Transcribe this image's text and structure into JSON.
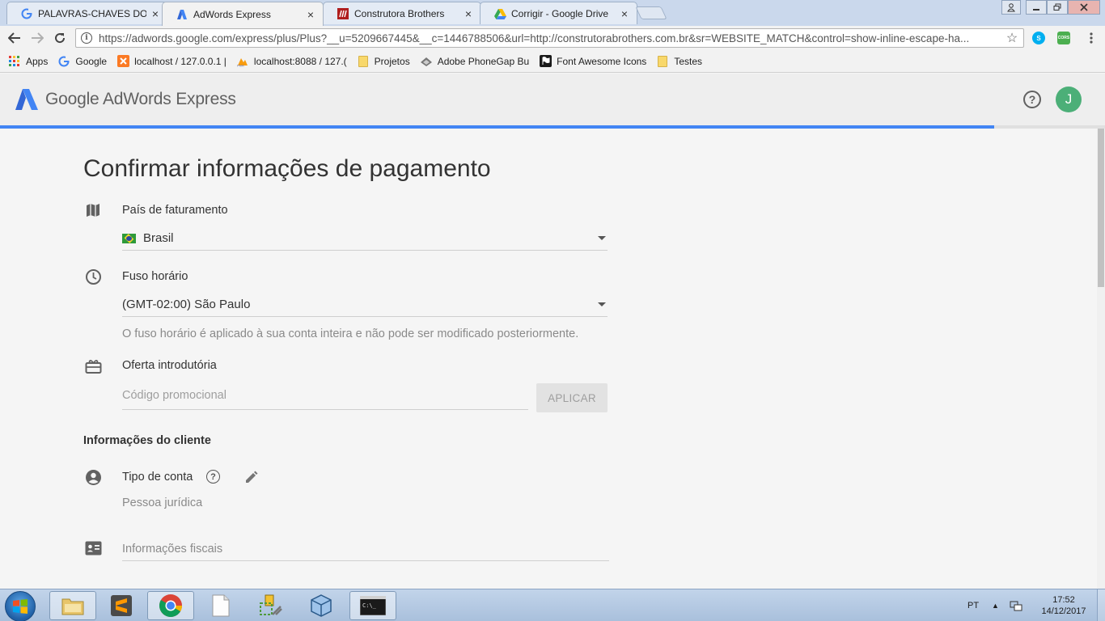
{
  "browser": {
    "tabs": [
      {
        "title": "PALAVRAS-CHAVES DO (",
        "icon": "google-g-icon",
        "active": false
      },
      {
        "title": "AdWords Express",
        "icon": "adwords-icon",
        "active": true
      },
      {
        "title": "Construtora Brothers",
        "icon": "construtora-icon",
        "active": false
      },
      {
        "title": "Corrigir - Google Drive",
        "icon": "google-drive-icon",
        "active": false
      }
    ],
    "url": "https://adwords.google.com/express/plus/Plus?__u=5209667445&__c=1446788506&url=http://construtorabrothers.com.br&sr=WEBSITE_MATCH&control=show-inline-escape-ha...",
    "extensions": [
      {
        "name": "skype-extension-icon",
        "label": "S",
        "color": "#00aff0"
      },
      {
        "name": "cors-extension-icon",
        "label": "CORS",
        "color": "#4caf50"
      }
    ],
    "bookmarks": [
      {
        "label": "Apps",
        "icon": "apps-grid-icon"
      },
      {
        "label": "Google",
        "icon": "google-g-icon"
      },
      {
        "label": "localhost / 127.0.0.1 |",
        "icon": "xampp-icon"
      },
      {
        "label": "localhost:8088 / 127.(",
        "icon": "phpmyadmin-icon"
      },
      {
        "label": "Projetos",
        "icon": "folder-icon"
      },
      {
        "label": "Adobe PhoneGap Bu",
        "icon": "phonegap-icon"
      },
      {
        "label": "Font Awesome Icons",
        "icon": "font-awesome-flag-icon"
      },
      {
        "label": "Testes",
        "icon": "folder-icon"
      }
    ]
  },
  "app": {
    "brand": "Google AdWords Express",
    "avatar_initial": "J",
    "accent_color": "#4285f4",
    "progress": 0.9
  },
  "form": {
    "title": "Confirmar informações de pagamento",
    "country": {
      "label": "País de faturamento",
      "value": "Brasil"
    },
    "timezone": {
      "label": "Fuso horário",
      "value": "(GMT-02:00) São Paulo",
      "hint": "O fuso horário é aplicado à sua conta inteira e não pode ser modificado posteriormente."
    },
    "offer": {
      "label": "Oferta introdutória",
      "placeholder": "Código promocional",
      "apply_label": "APLICAR"
    },
    "customer_section": "Informações do cliente",
    "account_type": {
      "label": "Tipo de conta",
      "value": "Pessoa jurídica"
    },
    "tax_info": {
      "label": "Informações fiscais"
    }
  },
  "taskbar": {
    "language": "PT",
    "time": "17:52",
    "date": "14/12/2017"
  }
}
